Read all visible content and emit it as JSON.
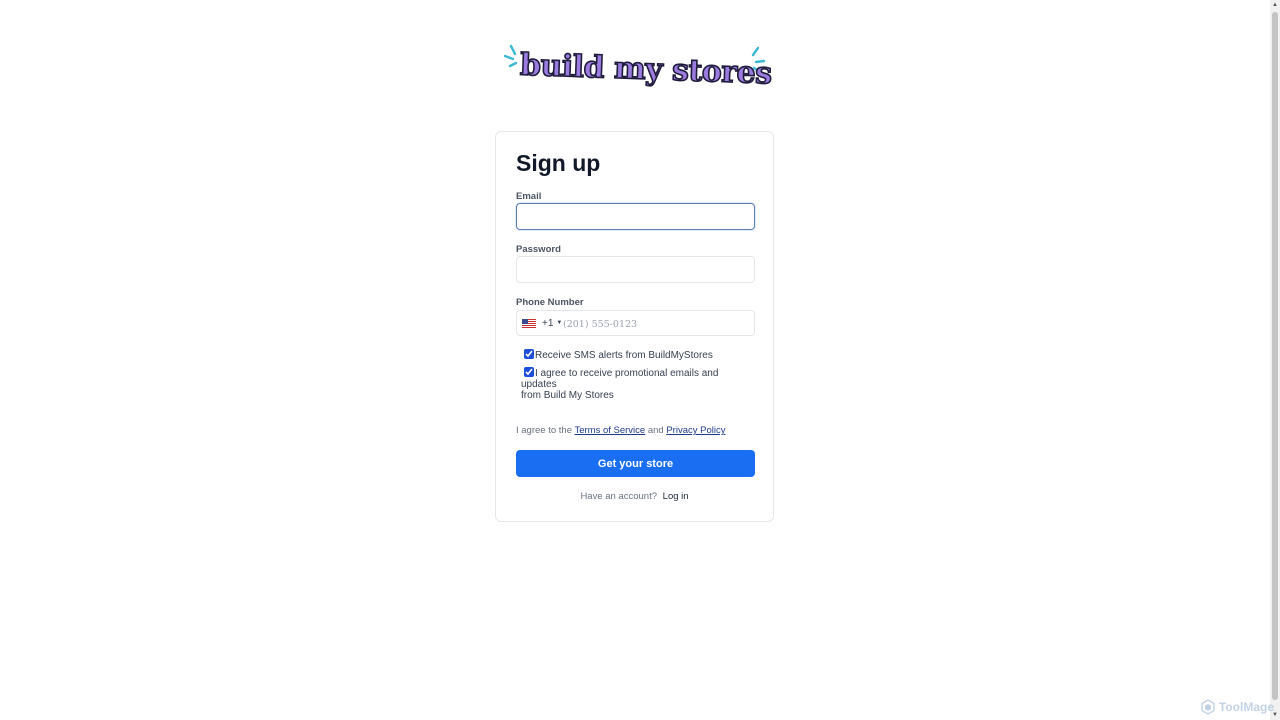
{
  "logo": {
    "text": "build my stores",
    "colors": {
      "fill": "#9b7be0",
      "outline": "#1f1b3a",
      "sparkle": "#3bb8d6"
    }
  },
  "form": {
    "title": "Sign up",
    "email_label": "Email",
    "email_value": "",
    "password_label": "Password",
    "password_value": "",
    "phone_label": "Phone Number",
    "country_flag": "us-flag-icon",
    "dial_code": "+1",
    "phone_placeholder": "(201) 555-0123",
    "phone_value": "",
    "sms_checkbox": {
      "label": "Receive SMS alerts from BuildMyStores",
      "checked": true
    },
    "promo_checkbox": {
      "label_line1": "I agree to receive promotional emails and updates",
      "label_line2": "from Build My Stores",
      "checked": true
    },
    "terms": {
      "prefix": "I agree to the",
      "tos_link": "Terms of Service",
      "and": "and",
      "privacy_link": "Privacy Policy"
    },
    "submit_label": "Get your store",
    "login_prompt": "Have an account?",
    "login_link": "Log in"
  },
  "watermark": {
    "text": "ToolMage"
  },
  "colors": {
    "primary": "#1a6ef2",
    "link": "#1e3a8a"
  }
}
